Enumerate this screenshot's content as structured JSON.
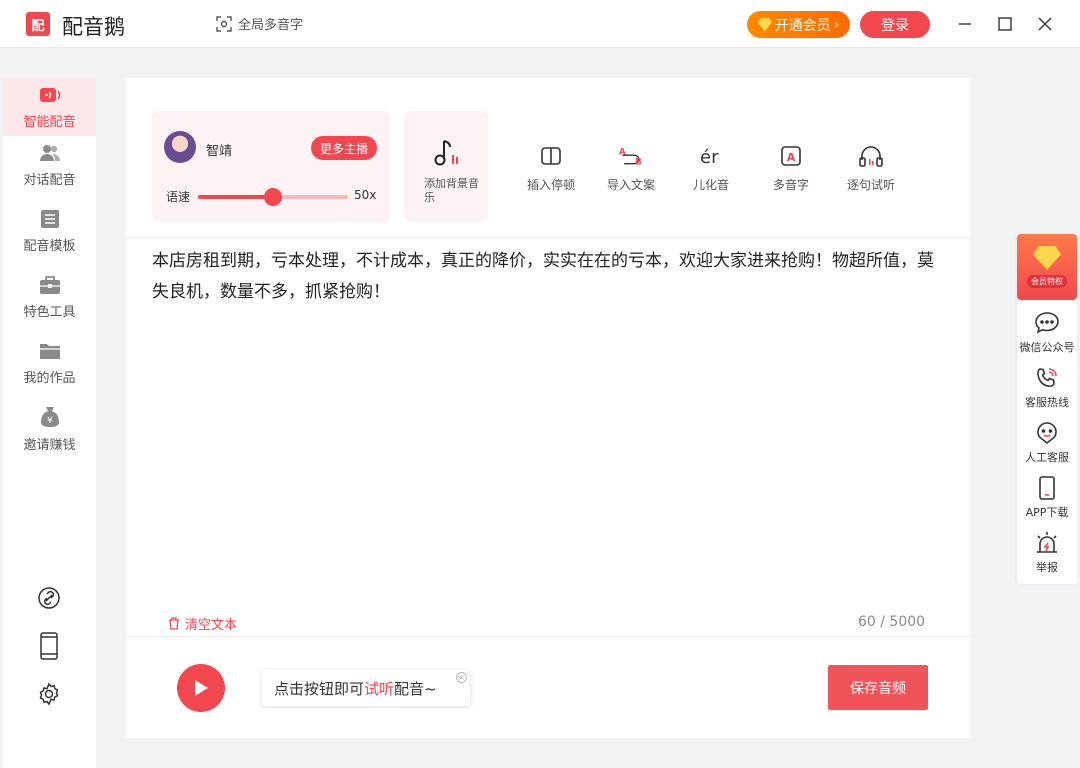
{
  "app": {
    "logo_text": "配",
    "name": "配音鹅"
  },
  "titlebar": {
    "global_label": "全局多音字",
    "vip_label": "开通会员",
    "login_label": "登录"
  },
  "sidebar": {
    "items": [
      {
        "label": "智能配音",
        "icon": "voice-icon"
      },
      {
        "label": "对话配音",
        "icon": "users-icon"
      },
      {
        "label": "配音模板",
        "icon": "template-icon"
      },
      {
        "label": "特色工具",
        "icon": "toolbox-icon"
      },
      {
        "label": "我的作品",
        "icon": "folder-icon"
      },
      {
        "label": "邀请赚钱",
        "icon": "moneybag-icon"
      }
    ]
  },
  "voice": {
    "name": "智靖",
    "more_label": "更多主播",
    "speed_label": "语速",
    "speed_value": "50x",
    "speed_fraction": 0.5
  },
  "music": {
    "label": "添加背景音乐"
  },
  "tools": [
    {
      "label": "插入停顿",
      "icon": "pause-icon"
    },
    {
      "label": "导入文案",
      "icon": "import-icon"
    },
    {
      "label": "儿化音",
      "icon": "er-icon"
    },
    {
      "label": "多音字",
      "icon": "polyphone-icon"
    },
    {
      "label": "逐句试听",
      "icon": "headphone-icon"
    }
  ],
  "editor": {
    "text": "本店房租到期，亏本处理，不计成本，真正的降价，实实在在的亏本，欢迎大家进来抢购！物超所值，莫失良机，数量不多，抓紧抢购！",
    "clear_label": "清空文本",
    "counter": "60 / 5000"
  },
  "footer": {
    "tip_before": "点击按钮即可",
    "tip_highlight": "试听",
    "tip_after": "配音~",
    "save_label": "保存音频"
  },
  "float_bar": {
    "vip_tag": "会员特权",
    "items": [
      {
        "label": "微信公众号",
        "icon": "wechat-icon"
      },
      {
        "label": "客服热线",
        "icon": "phone-icon"
      },
      {
        "label": "人工客服",
        "icon": "service-icon"
      },
      {
        "label": "APP下载",
        "icon": "mobile-icon"
      },
      {
        "label": "举报",
        "icon": "alarm-icon"
      }
    ]
  },
  "colors": {
    "accent": "#f2474f",
    "vip_orange": "#ff7a00",
    "active_bg": "#fde8e9"
  }
}
